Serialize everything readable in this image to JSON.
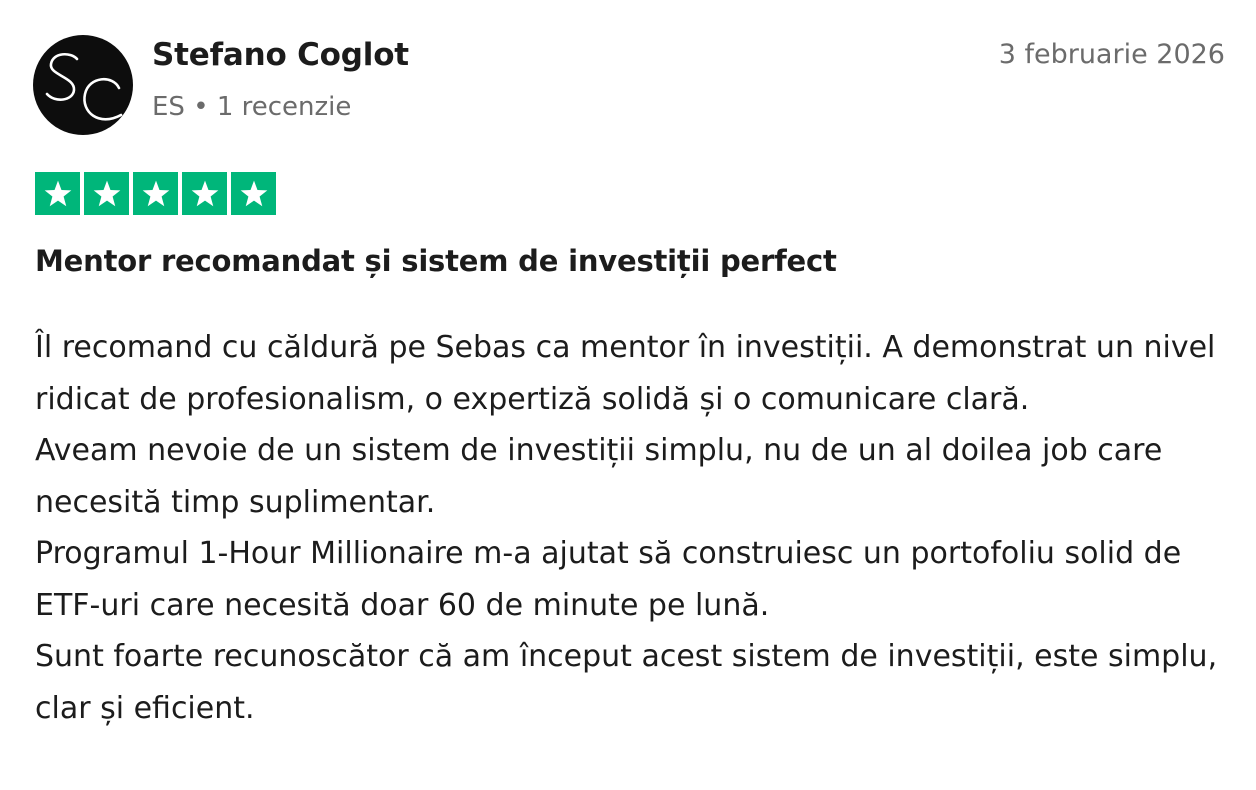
{
  "reviewer": {
    "initials": "SC",
    "name": "Stefano Coglot",
    "country": "ES",
    "separator": "•",
    "review_count": "1 recenzie"
  },
  "review": {
    "date": "3 februarie 2026",
    "rating": 5,
    "rating_max": 5,
    "star_color": "#00b67a",
    "title": "Mentor recomandat și sistem de investiții perfect",
    "paragraphs": [
      "Îl recomand cu căldură pe Sebas ca mentor în investiții. A demonstrat un nivel ridicat de profesionalism, o expertiză solidă și o comunicare clară.",
      "Aveam nevoie de un sistem de investiții simplu, nu de un al doilea job care necesită timp suplimentar.",
      "Programul 1-Hour Millionaire m-a ajutat să construiesc un portofoliu solid de ETF-uri care necesită doar 60 de minute pe lună.",
      "Sunt foarte recunoscător că am început acest sistem de investiții, este simplu, clar și eficient."
    ]
  }
}
